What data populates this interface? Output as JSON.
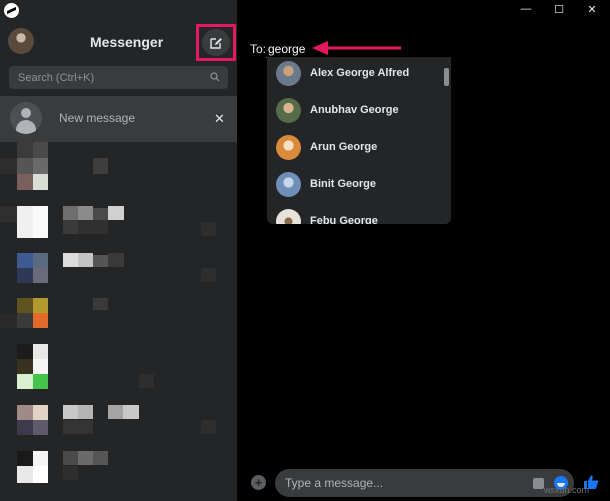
{
  "app": {
    "title": "Messenger"
  },
  "sidebar": {
    "search": {
      "placeholder": "Search (Ctrl+K)"
    },
    "new_message": {
      "label": "New message",
      "close_glyph": "✕"
    }
  },
  "window_controls": {
    "minimize": "—",
    "maximize": "☐",
    "close": "✕"
  },
  "recipient": {
    "label": "To:",
    "value": "george"
  },
  "suggestions": [
    {
      "name": "Alex George Alfred",
      "avatar_colors": [
        "#6a7a8c",
        "#c9a07a"
      ]
    },
    {
      "name": "Anubhav George",
      "avatar_colors": [
        "#556b4a",
        "#d9b48f"
      ]
    },
    {
      "name": "Arun George",
      "avatar_colors": [
        "#d98a3a",
        "#f2e0c8"
      ]
    },
    {
      "name": "Binit George",
      "avatar_colors": [
        "#6f8fb8",
        "#c8d8ea"
      ]
    },
    {
      "name": "Febu George",
      "avatar_colors": [
        "#e8e2da",
        "#8a6a4a"
      ]
    }
  ],
  "composer": {
    "placeholder": "Type a message...",
    "add_glyph": "+"
  },
  "watermark": "wsxdn.com",
  "colors": {
    "highlight": "#e5195f",
    "accent": "#1877f2",
    "sidebar_bg": "#242526",
    "main_bg": "#000000"
  },
  "icons": [
    "messenger-logo-icon",
    "compose-icon",
    "search-icon",
    "default-avatar-icon",
    "close-icon",
    "pointer-arrow-icon",
    "plus-icon",
    "sticker-icon",
    "emoji-icon",
    "like-icon"
  ]
}
